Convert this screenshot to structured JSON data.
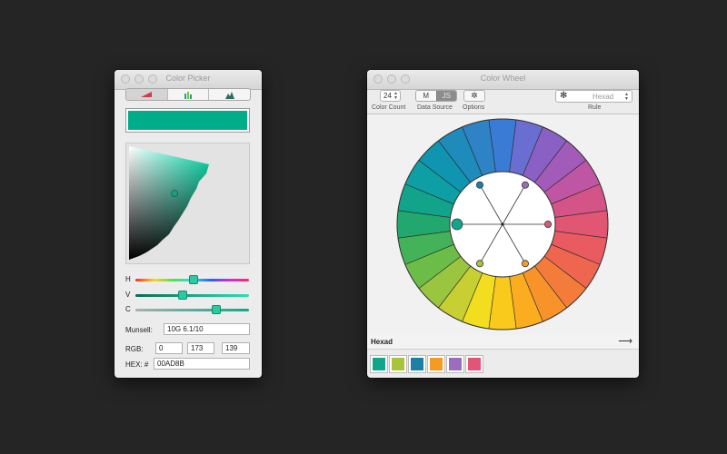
{
  "picker": {
    "title": "Color Picker",
    "preview_color": "#00AD8B",
    "sliders": {
      "h_label": "H",
      "v_label": "V",
      "c_label": "C"
    },
    "munsell_label": "Munsell:",
    "munsell_value": "10G 6.1/10",
    "rgb_label": "RGB:",
    "r": "0",
    "g": "173",
    "b": "139",
    "hex_label": "HEX: #",
    "hex_value": "00AD8B"
  },
  "wheel": {
    "title": "Color Wheel",
    "color_count": "24",
    "color_count_caption": "Color Count",
    "data_source_m": "M",
    "data_source_js": "JS",
    "data_source_caption": "Data Source",
    "options_caption": "Options",
    "options_icon": "gear-icon",
    "rule_value": "Hexad",
    "rule_caption": "Rule",
    "rule_icon": "hexad-icon",
    "harmony_label": "Hexad",
    "arrow": "⟶",
    "swatches": [
      "#10A68A",
      "#A9C43A",
      "#1C7FA6",
      "#F59A22",
      "#9A6DC0",
      "#E05677"
    ],
    "ring_colors": [
      "#3a7bd6",
      "#6a6ed0",
      "#8a60c4",
      "#a25bb8",
      "#c056a3",
      "#d45487",
      "#e05673",
      "#e95a61",
      "#ef6650",
      "#f47c3a",
      "#f8932a",
      "#fbad1f",
      "#f9c91c",
      "#f2dd1f",
      "#c8cf33",
      "#99c53f",
      "#6cbd48",
      "#43b259",
      "#22a86e",
      "#12a38b",
      "#0d9fa4",
      "#1095b1",
      "#1f8bba",
      "#2d83c6"
    ],
    "handles": [
      {
        "color": "#1C7FA6"
      },
      {
        "color": "#9A6DC0"
      },
      {
        "color": "#E05677"
      },
      {
        "color": "#F59A22"
      },
      {
        "color": "#A9C43A"
      },
      {
        "color": "#10A68A"
      }
    ]
  }
}
